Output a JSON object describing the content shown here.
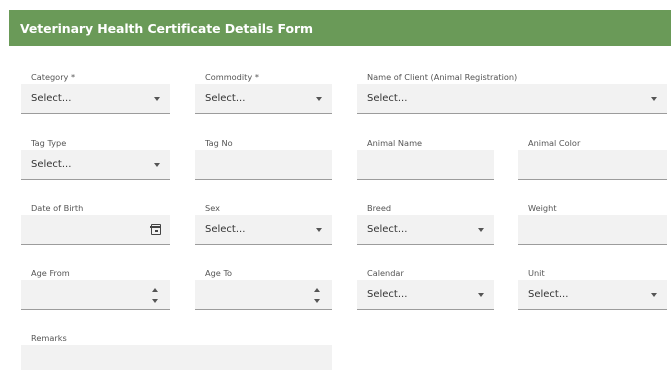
{
  "header": {
    "title": "Veterinary Health Certificate Details Form"
  },
  "fields": {
    "category": {
      "label": "Category *",
      "value": "Select..."
    },
    "commodity": {
      "label": "Commodity *",
      "value": "Select..."
    },
    "client": {
      "label": "Name of Client (Animal Registration)",
      "value": "Select..."
    },
    "tag_type": {
      "label": "Tag Type",
      "value": "Select..."
    },
    "tag_no": {
      "label": "Tag No",
      "value": ""
    },
    "animal_name": {
      "label": "Animal Name",
      "value": ""
    },
    "animal_color": {
      "label": "Animal Color",
      "value": ""
    },
    "dob": {
      "label": "Date of Birth",
      "value": "",
      "icon": "calendar-icon"
    },
    "sex": {
      "label": "Sex",
      "value": "Select..."
    },
    "breed": {
      "label": "Breed",
      "value": "Select..."
    },
    "weight": {
      "label": "Weight",
      "value": ""
    },
    "age_from": {
      "label": "Age From",
      "value": ""
    },
    "age_to": {
      "label": "Age To",
      "value": ""
    },
    "calendar": {
      "label": "Calendar",
      "value": "Select..."
    },
    "unit": {
      "label": "Unit",
      "value": "Select..."
    },
    "remarks": {
      "label": "Remarks",
      "value": ""
    }
  },
  "colors": {
    "header_bg": "#6a9a58",
    "field_bg": "#f2f2f2",
    "underline": "#9c9c9c"
  }
}
